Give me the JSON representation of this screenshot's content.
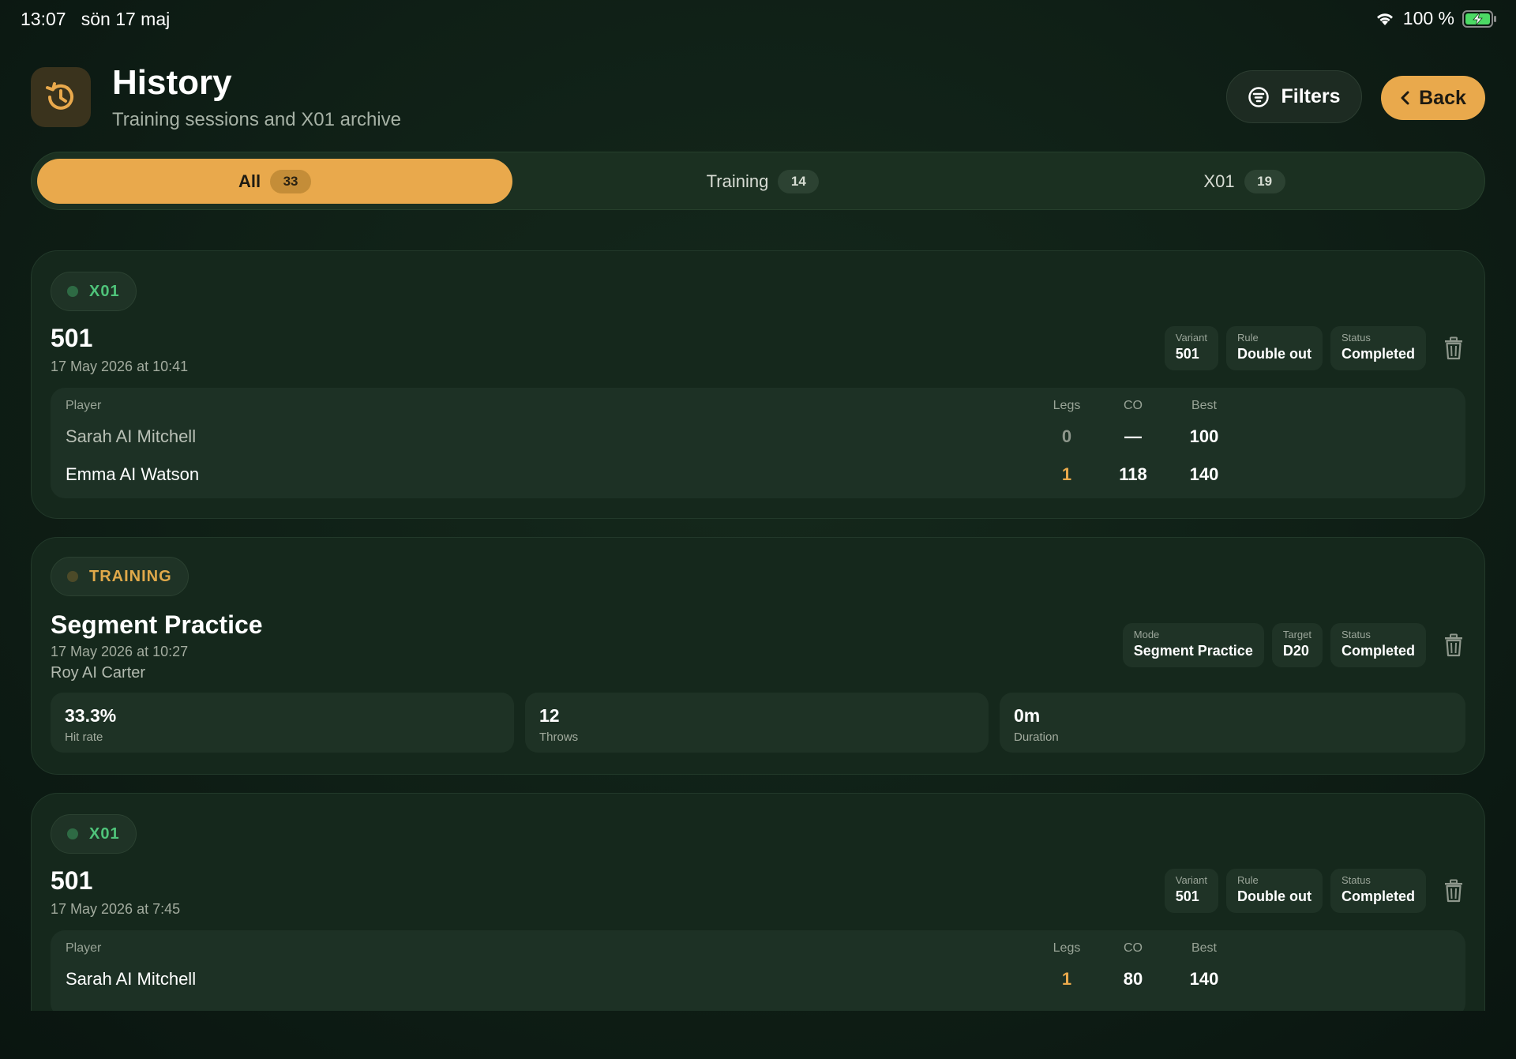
{
  "status_bar": {
    "time": "13:07",
    "date": "sön 17 maj",
    "battery": "100 %"
  },
  "header": {
    "title": "History",
    "subtitle": "Training sessions and X01 archive",
    "filters_label": "Filters",
    "back_label": "Back"
  },
  "tabs": [
    {
      "label": "All",
      "count": "33",
      "active": true
    },
    {
      "label": "Training",
      "count": "14",
      "active": false
    },
    {
      "label": "X01",
      "count": "19",
      "active": false
    }
  ],
  "colors": {
    "accent": "#e9a94c",
    "x01": "#4fc47a",
    "training": "#e0a94a",
    "background": "#102016"
  },
  "cards": [
    {
      "type_label": "X01",
      "title": "501",
      "date": "17 May 2026 at 10:41",
      "meta": [
        {
          "key": "Variant",
          "value": "501"
        },
        {
          "key": "Rule",
          "value": "Double out"
        },
        {
          "key": "Status",
          "value": "Completed"
        }
      ],
      "headers": {
        "player": "Player",
        "legs": "Legs",
        "co": "CO",
        "best": "Best"
      },
      "players": [
        {
          "name": "Sarah AI Mitchell",
          "legs": "0",
          "co": "—",
          "best": "100"
        },
        {
          "name": "Emma AI Watson",
          "legs": "1",
          "co": "118",
          "best": "140"
        }
      ]
    },
    {
      "type_label": "TRAINING",
      "title": "Segment Practice",
      "date": "17 May 2026 at 10:27",
      "player": "Roy AI Carter",
      "meta": [
        {
          "key": "Mode",
          "value": "Segment Practice"
        },
        {
          "key": "Target",
          "value": "D20"
        },
        {
          "key": "Status",
          "value": "Completed"
        }
      ],
      "stats": [
        {
          "value": "33.3%",
          "label": "Hit rate"
        },
        {
          "value": "12",
          "label": "Throws"
        },
        {
          "value": "0m",
          "label": "Duration"
        }
      ]
    },
    {
      "type_label": "X01",
      "title": "501",
      "date": "17 May 2026 at 7:45",
      "meta": [
        {
          "key": "Variant",
          "value": "501"
        },
        {
          "key": "Rule",
          "value": "Double out"
        },
        {
          "key": "Status",
          "value": "Completed"
        }
      ],
      "headers": {
        "player": "Player",
        "legs": "Legs",
        "co": "CO",
        "best": "Best"
      },
      "players": [
        {
          "name": "Sarah AI Mitchell",
          "legs": "1",
          "co": "80",
          "best": "140"
        }
      ]
    }
  ]
}
